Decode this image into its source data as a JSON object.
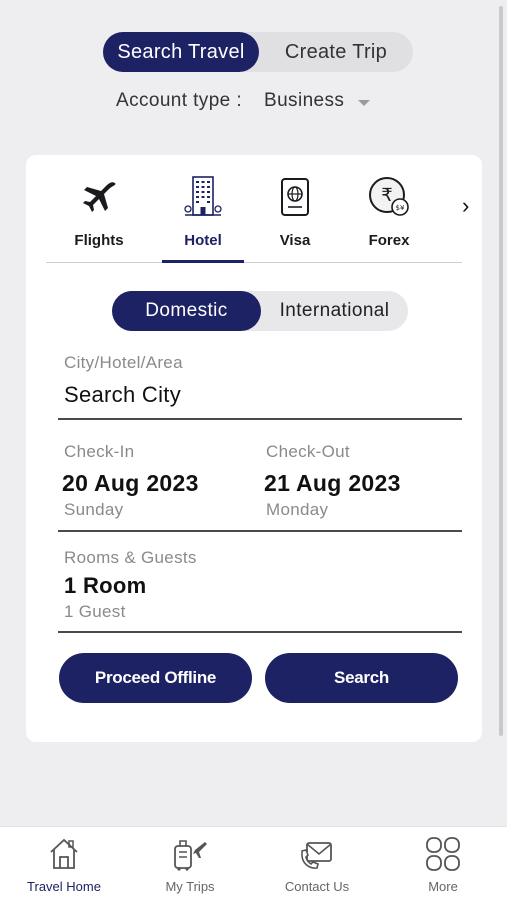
{
  "top_toggle": {
    "active": "Search Travel",
    "inactive": "Create Trip"
  },
  "account": {
    "label": "Account type :",
    "value": "Business"
  },
  "services": [
    {
      "label": "Flights",
      "icon": "airplane-icon"
    },
    {
      "label": "Hotel",
      "icon": "hotel-building-icon"
    },
    {
      "label": "Visa",
      "icon": "passport-icon"
    },
    {
      "label": "Forex",
      "icon": "rupee-coin-icon"
    }
  ],
  "scope_toggle": {
    "active": "Domestic",
    "inactive": "International"
  },
  "city": {
    "label": "City/Hotel/Area",
    "value": "Search City"
  },
  "check_in": {
    "label": "Check-In",
    "date": "20 Aug 2023",
    "day": "Sunday"
  },
  "check_out": {
    "label": "Check-Out",
    "date": "21 Aug 2023",
    "day": "Monday"
  },
  "rooms": {
    "label": "Rooms & Guests",
    "rooms": "1 Room",
    "guests": "1 Guest"
  },
  "buttons": {
    "offline": "Proceed Offline",
    "search": "Search"
  },
  "bottom_nav": [
    {
      "label": "Travel Home",
      "icon": "home-icon"
    },
    {
      "label": "My Trips",
      "icon": "luggage-icon"
    },
    {
      "label": "Contact Us",
      "icon": "contact-mail-icon"
    },
    {
      "label": "More",
      "icon": "grid-more-icon"
    }
  ],
  "colors": {
    "accent": "#1c2263",
    "background": "#eeeef0",
    "card": "#ffffff"
  }
}
